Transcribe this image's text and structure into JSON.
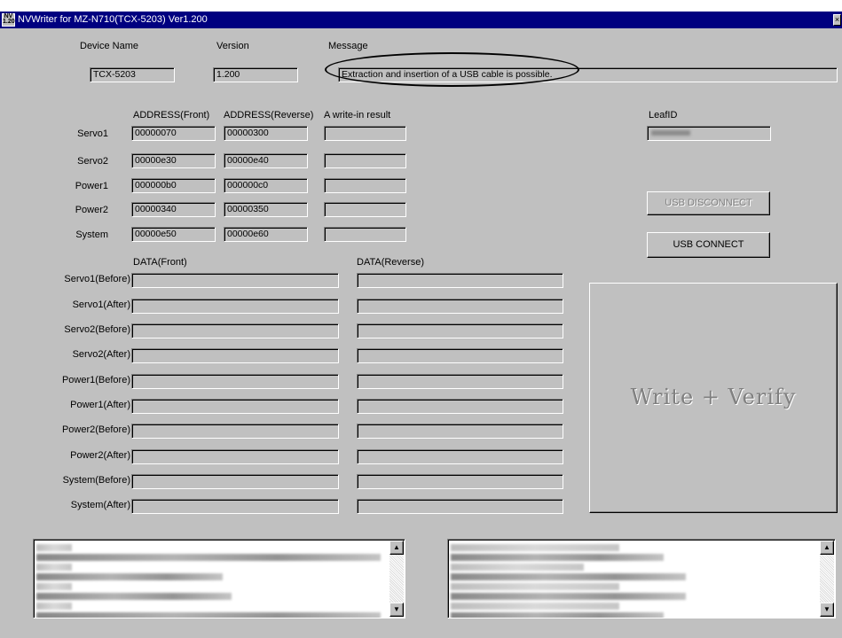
{
  "window": {
    "title": "NVWriter for MZ-N710(TCX-5203) Ver1.200",
    "icon_text": "NV 1.20",
    "close_glyph": "×"
  },
  "header": {
    "device_name_label": "Device Name",
    "version_label": "Version",
    "message_label": "Message",
    "device_name_value": "TCX-5203",
    "version_value": "1.200",
    "message_value": "Extraction and insertion of a USB cable is possible."
  },
  "address_table": {
    "col_front": "ADDRESS(Front)",
    "col_reverse": "ADDRESS(Reverse)",
    "col_result": "A write-in result",
    "rows": [
      {
        "label": "Servo1",
        "front": "00000070",
        "reverse": "00000300",
        "result": ""
      },
      {
        "label": "Servo2",
        "front": "00000e30",
        "reverse": "00000e40",
        "result": ""
      },
      {
        "label": "Power1",
        "front": "000000b0",
        "reverse": "000000c0",
        "result": ""
      },
      {
        "label": "Power2",
        "front": "00000340",
        "reverse": "00000350",
        "result": ""
      },
      {
        "label": "System",
        "front": "00000e50",
        "reverse": "00000e60",
        "result": ""
      }
    ]
  },
  "leaf": {
    "label": "LeafID"
  },
  "buttons": {
    "usb_disconnect": "USB DISCONNECT",
    "usb_connect": "USB CONNECT",
    "write_verify": "Write + Verify"
  },
  "data_table": {
    "col_front": "DATA(Front)",
    "col_reverse": "DATA(Reverse)",
    "rows": [
      {
        "label": "Servo1(Before)",
        "front": "",
        "reverse": ""
      },
      {
        "label": "Servo1(After)",
        "front": "",
        "reverse": ""
      },
      {
        "label": "Servo2(Before)",
        "front": "",
        "reverse": ""
      },
      {
        "label": "Servo2(After)",
        "front": "",
        "reverse": ""
      },
      {
        "label": "Power1(Before)",
        "front": "",
        "reverse": ""
      },
      {
        "label": "Power1(After)",
        "front": "",
        "reverse": ""
      },
      {
        "label": "Power2(Before)",
        "front": "",
        "reverse": ""
      },
      {
        "label": "Power2(After)",
        "front": "",
        "reverse": ""
      },
      {
        "label": "System(Before)",
        "front": "",
        "reverse": ""
      },
      {
        "label": "System(After)",
        "front": "",
        "reverse": ""
      }
    ]
  },
  "logs": {
    "scroll_up_glyph": "▲",
    "scroll_down_glyph": "▼"
  }
}
